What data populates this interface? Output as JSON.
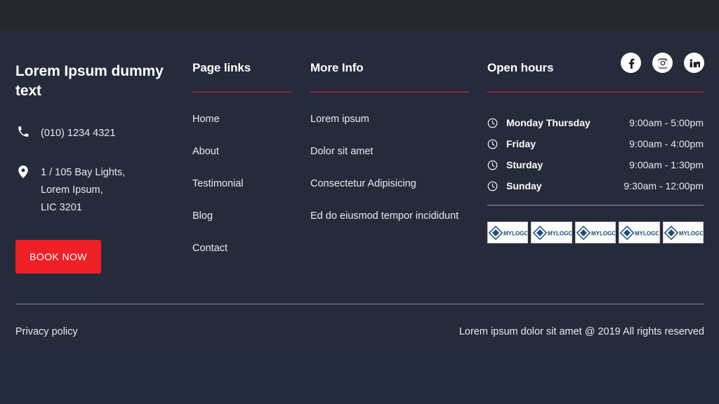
{
  "theme": {
    "band_top_color": "#26262e",
    "band_main_color": "#252b3b",
    "band_bottom_color": "#222b40",
    "accent_red": "#ee2026",
    "rule_red": "#8e2636",
    "rule_gray": "#8e93a3",
    "text_color": "#e8eaee"
  },
  "brand": {
    "title": "Lorem Ipsum dummy text",
    "phone_icon": "phone-icon",
    "phone": "(010) 1234 4321",
    "location_icon": "location-pin-icon",
    "address": "1 / 105 Bay Lights,\nLorem Ipsum,\nLIC 3201",
    "book_button_label": "BOOK NOW"
  },
  "page_links": {
    "heading": "Page links",
    "items": [
      {
        "label": "Home"
      },
      {
        "label": "About"
      },
      {
        "label": "Testimonial"
      },
      {
        "label": "Blog"
      },
      {
        "label": "Contact"
      }
    ]
  },
  "more_info": {
    "heading": "More Info",
    "items": [
      {
        "label": "Lorem ipsum"
      },
      {
        "label": "Dolor sit amet"
      },
      {
        "label": "Consectetur Adipisicing"
      },
      {
        "label": "Ed do eiusmod tempor incididunt"
      }
    ]
  },
  "open_hours": {
    "heading": "Open hours",
    "clock_icon": "clock-icon",
    "rows": [
      {
        "day": "Monday Thursday",
        "time": "9:00am - 5:00pm"
      },
      {
        "day": "Friday",
        "time": "9:00am - 4:00pm"
      },
      {
        "day": "Sturday",
        "time": "9:00am - 1:30pm"
      },
      {
        "day": "Sunday",
        "time": "9:30am - 12:00pm"
      }
    ]
  },
  "social": {
    "items": [
      {
        "icon": "facebook-icon",
        "name": "Facebook"
      },
      {
        "icon": "instagram-icon",
        "name": "Instagram"
      },
      {
        "icon": "linkedin-icon",
        "name": "LinkedIn"
      }
    ]
  },
  "partner_logos": {
    "items": [
      {
        "label": "MYLOGO"
      },
      {
        "label": "MYLOGO"
      },
      {
        "label": "MYLOGO"
      },
      {
        "label": "MYLOGO"
      },
      {
        "label": "MYLOGO"
      }
    ]
  },
  "bottom_bar": {
    "privacy_label": "Privacy policy",
    "copyright": "Lorem ipsum dolor sit amet @ 2019 All rights reserved"
  }
}
